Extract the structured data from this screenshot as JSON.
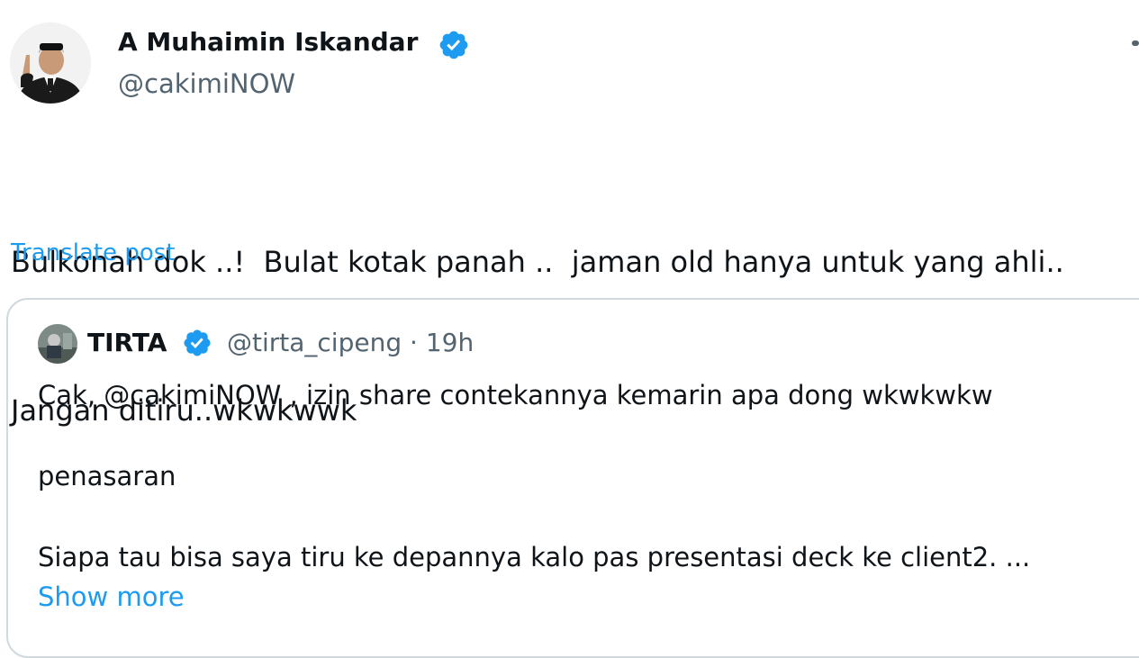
{
  "post": {
    "author": {
      "name": "A Muhaimin Iskandar",
      "handle": "@cakimiNOW",
      "verified": true
    },
    "text_lines": [
      "Bulkonah dok ..!  Bulat kotak panah ..  jaman old hanya untuk yang ahli..",
      "Jangan ditiru..wkwkwwk"
    ],
    "translate_label": "Translate post"
  },
  "quoted_post": {
    "author": {
      "name": "TIRTA",
      "handle": "@tirta_cipeng",
      "verified": true
    },
    "separator": "·",
    "time": "19h",
    "text_lines": [
      "Cak,  @cakimiNOW , izin share contekannya kemarin apa dong wkwkwkw",
      "penasaran",
      "Siapa tau bisa saya tiru ke depannya kalo pas presentasi deck ke client2. ..."
    ],
    "show_more_label": "Show more"
  },
  "colors": {
    "text": "#0f1419",
    "secondary": "#536471",
    "accent": "#1d9bf0",
    "border": "#cfd9de"
  },
  "icons": [
    "verified-badge-icon",
    "more-options-icon"
  ]
}
